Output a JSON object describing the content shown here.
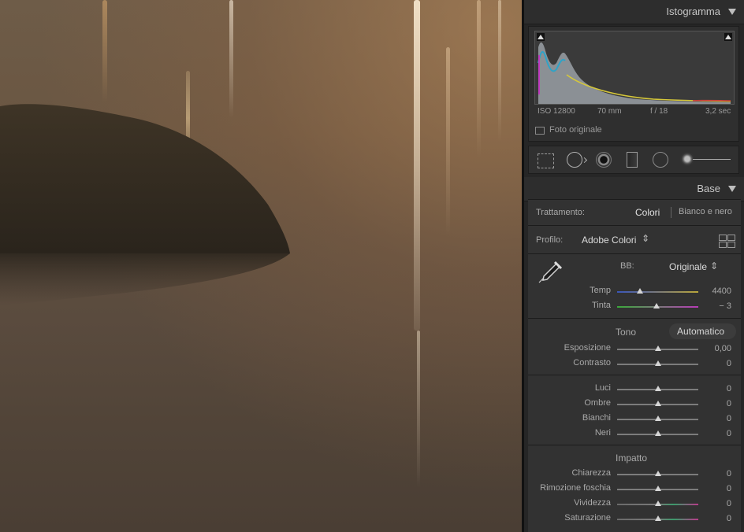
{
  "histogram": {
    "title": "Istogramma",
    "iso": "ISO 12800",
    "focal": "70 mm",
    "aperture": "f / 18",
    "shutter": "3,2 sec",
    "original_label": "Foto originale",
    "original_checked": false
  },
  "tools": [
    "crop-icon",
    "spot-removal-icon",
    "redeye-icon",
    "graduated-filter-icon",
    "radial-filter-icon",
    "adjustment-brush-icon"
  ],
  "base": {
    "title": "Base",
    "treatment_label": "Trattamento:",
    "treatment_color": "Colori",
    "treatment_bw": "Bianco e nero",
    "profile_label": "Profilo:",
    "profile_value": "Adobe Colori",
    "wb_label": "BB:",
    "wb_value": "Originale",
    "temp_label": "Temp",
    "temp_value": "4400",
    "temp_level": 0.28,
    "tint_label": "Tinta",
    "tint_value": "− 3",
    "tint_level": 0.49,
    "tone_label": "Tono",
    "auto_label": "Automatico",
    "presence_label": "Impatto",
    "sliders_tone": [
      {
        "label": "Esposizione",
        "value": "0,00",
        "level": 0.5
      },
      {
        "label": "Contrasto",
        "value": "0",
        "level": 0.5
      }
    ],
    "sliders_light": [
      {
        "label": "Luci",
        "value": "0",
        "level": 0.5
      },
      {
        "label": "Ombre",
        "value": "0",
        "level": 0.5
      },
      {
        "label": "Bianchi",
        "value": "0",
        "level": 0.5
      },
      {
        "label": "Neri",
        "value": "0",
        "level": 0.5
      }
    ],
    "sliders_presence": [
      {
        "label": "Chiarezza",
        "value": "0",
        "level": 0.5
      },
      {
        "label": "Rimozione foschia",
        "value": "0",
        "level": 0.5
      },
      {
        "label": "Vividezza",
        "value": "0",
        "level": 0.5
      },
      {
        "label": "Saturazione",
        "value": "0",
        "level": 0.5
      }
    ]
  }
}
